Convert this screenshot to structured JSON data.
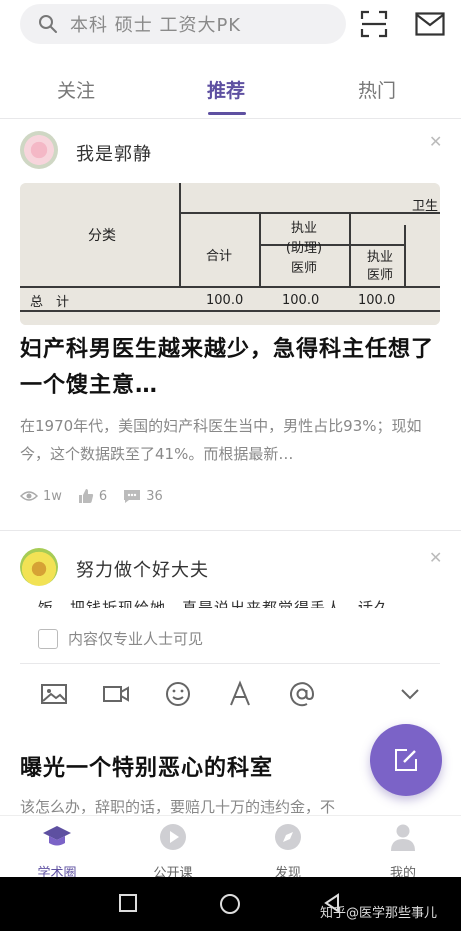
{
  "search": {
    "placeholder": "本科 硕士 工资大PK"
  },
  "tabs": [
    {
      "label": "关注",
      "active": false
    },
    {
      "label": "推荐",
      "active": true
    },
    {
      "label": "热门",
      "active": false
    }
  ],
  "post1": {
    "username": "我是郭静",
    "title": "妇产科男医生越来越少，急得科主任想了一个馊主意…",
    "excerpt": "在1970年代，美国的妇产科医生当中，男性占比93%；现如今，这个数据跌至了41%。而根据最新…",
    "views": "1w",
    "likes": "6",
    "comments": "36",
    "image_text": {
      "col_category": "分类",
      "col_total": "合计",
      "col_assistant": "执业\n(助理)\n医师",
      "col_licensed": "执业\n医师",
      "col_health": "卫生",
      "row_total": "总　计",
      "v1": "100.0",
      "v2": "100.0",
      "v3": "100.0"
    }
  },
  "post2": {
    "username": "努力做个好大夫",
    "clipped_text": "饭　把钱折现给她　真是说出来都觉得丢人　话久",
    "checkbox_label": "内容仅专业人士可见"
  },
  "post3": {
    "title": "曝光一个特别恶心的科室",
    "excerpt": "该怎么办，辞职的话，要赔几十万的违约金，不"
  },
  "bottom_nav": [
    {
      "label": "学术圈",
      "active": true
    },
    {
      "label": "公开课",
      "active": false
    },
    {
      "label": "发现",
      "active": false
    },
    {
      "label": "我的",
      "active": false
    }
  ],
  "watermark": "知乎@医学那些事儿",
  "colors": {
    "accent": "#5e50a1",
    "fab": "#7b63c7"
  }
}
